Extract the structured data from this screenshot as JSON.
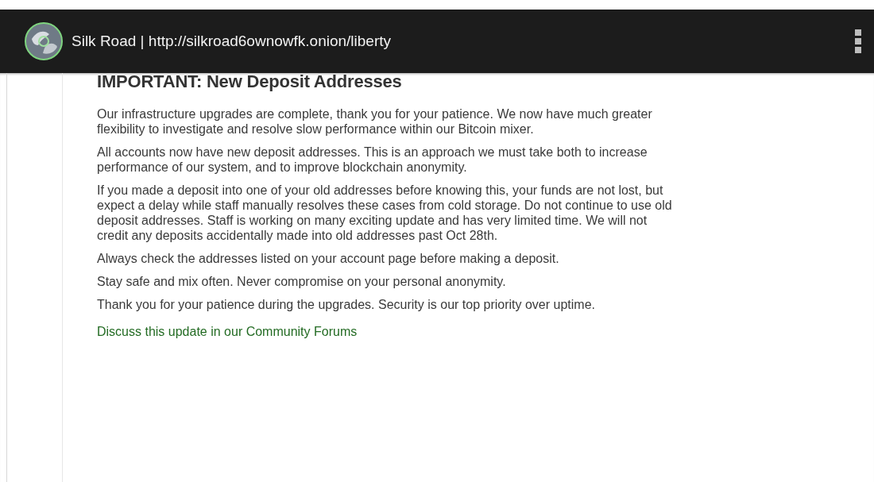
{
  "toolbar": {
    "title": "Silk Road | http://silkroad6ownowfk.onion/liberty"
  },
  "article": {
    "heading": "IMPORTANT: New Deposit Addresses",
    "paragraphs": [
      "Our infrastructure upgrades are complete, thank you for your patience. We now have much greater flexibility to investigate and resolve slow performance within our Bitcoin mixer.",
      "All accounts now have new deposit addresses. This is an approach we must take both to increase performance of our system, and to improve blockchain anonymity.",
      "If you made a deposit into one of your old addresses before knowing this, your funds are not lost, but expect a delay while staff manually resolves these cases from cold storage. Do not continue to use old deposit addresses. Staff is working on many exciting update and has very limited time. We will not credit any deposits accidentally made into old addresses past Oct 28th.",
      "Always check the addresses listed on your account page before making a deposit.",
      "Stay safe and mix often. Never compromise on your personal anonymity.",
      "Thank you for your patience during the upgrades. Security is our top priority over uptime."
    ],
    "link": "Discuss this update in our Community Forums"
  }
}
